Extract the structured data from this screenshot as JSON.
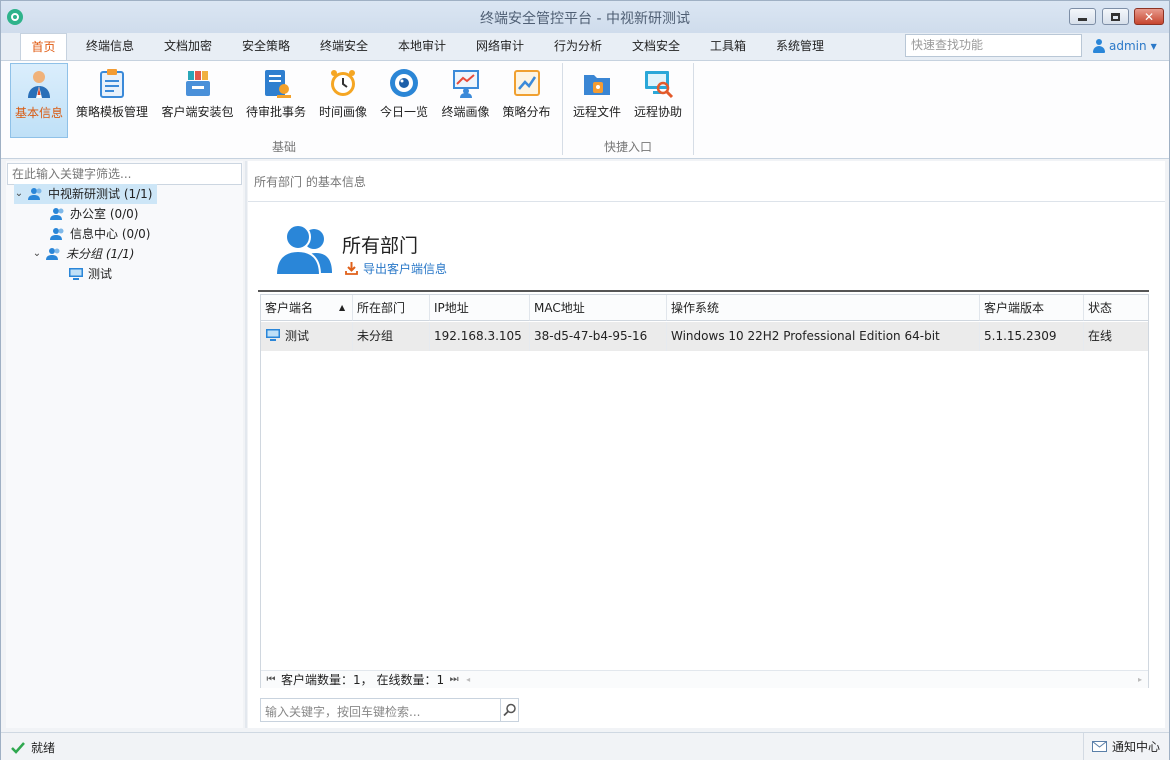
{
  "window": {
    "title": "终端安全管控平台 - 中视新研测试"
  },
  "menu": {
    "tabs": [
      "首页",
      "终端信息",
      "文档加密",
      "安全策略",
      "终端安全",
      "本地审计",
      "网络审计",
      "行为分析",
      "文档安全",
      "工具箱",
      "系统管理"
    ],
    "search_placeholder": "快速查找功能",
    "user": "admin"
  },
  "ribbon": {
    "groups": [
      {
        "label": "基础",
        "items": [
          "基本信息",
          "策略模板管理",
          "客户端安装包",
          "待审批事务",
          "时间画像",
          "今日一览",
          "终端画像",
          "策略分布"
        ]
      },
      {
        "label": "快捷入口",
        "items": [
          "远程文件",
          "远程协助"
        ]
      }
    ],
    "active_item": "基本信息"
  },
  "sidebar": {
    "filter_placeholder": "在此输入关键字筛选...",
    "tree": [
      {
        "label": "中视新研测试 (1/1)",
        "level": 0,
        "expanded": true,
        "selected": true,
        "icon": "group-icon"
      },
      {
        "label": "办公室 (0/0)",
        "level": 1,
        "icon": "group-icon"
      },
      {
        "label": "信息中心 (0/0)",
        "level": 1,
        "icon": "group-icon"
      },
      {
        "label": "未分组 (1/1)",
        "level": 1,
        "expanded": true,
        "italic": true,
        "icon": "group-icon"
      },
      {
        "label": "测试",
        "level": 2,
        "icon": "computer-icon"
      }
    ]
  },
  "main": {
    "breadcrumb": "所有部门 的基本信息",
    "dept_title": "所有部门",
    "export_label": "导出客户端信息",
    "table": {
      "columns": [
        "客户端名",
        "所在部门",
        "IP地址",
        "MAC地址",
        "操作系统",
        "客户端版本",
        "状态"
      ],
      "sort_column": "客户端名",
      "rows": [
        [
          "测试",
          "未分组",
          "192.168.3.105",
          "38-d5-47-b4-95-16",
          "Windows 10 22H2 Professional Edition 64-bit",
          "5.1.15.2309",
          "在线"
        ]
      ]
    },
    "pager_text": "客户端数量：1， 在线数量：1",
    "search_placeholder": "输入关键字，按回车键检索..."
  },
  "statusbar": {
    "ready": "就绪",
    "notify": "通知中心"
  },
  "colors": {
    "accent": "#2a78c8",
    "active_tab": "#e05a10",
    "online": "#2fa84f"
  }
}
